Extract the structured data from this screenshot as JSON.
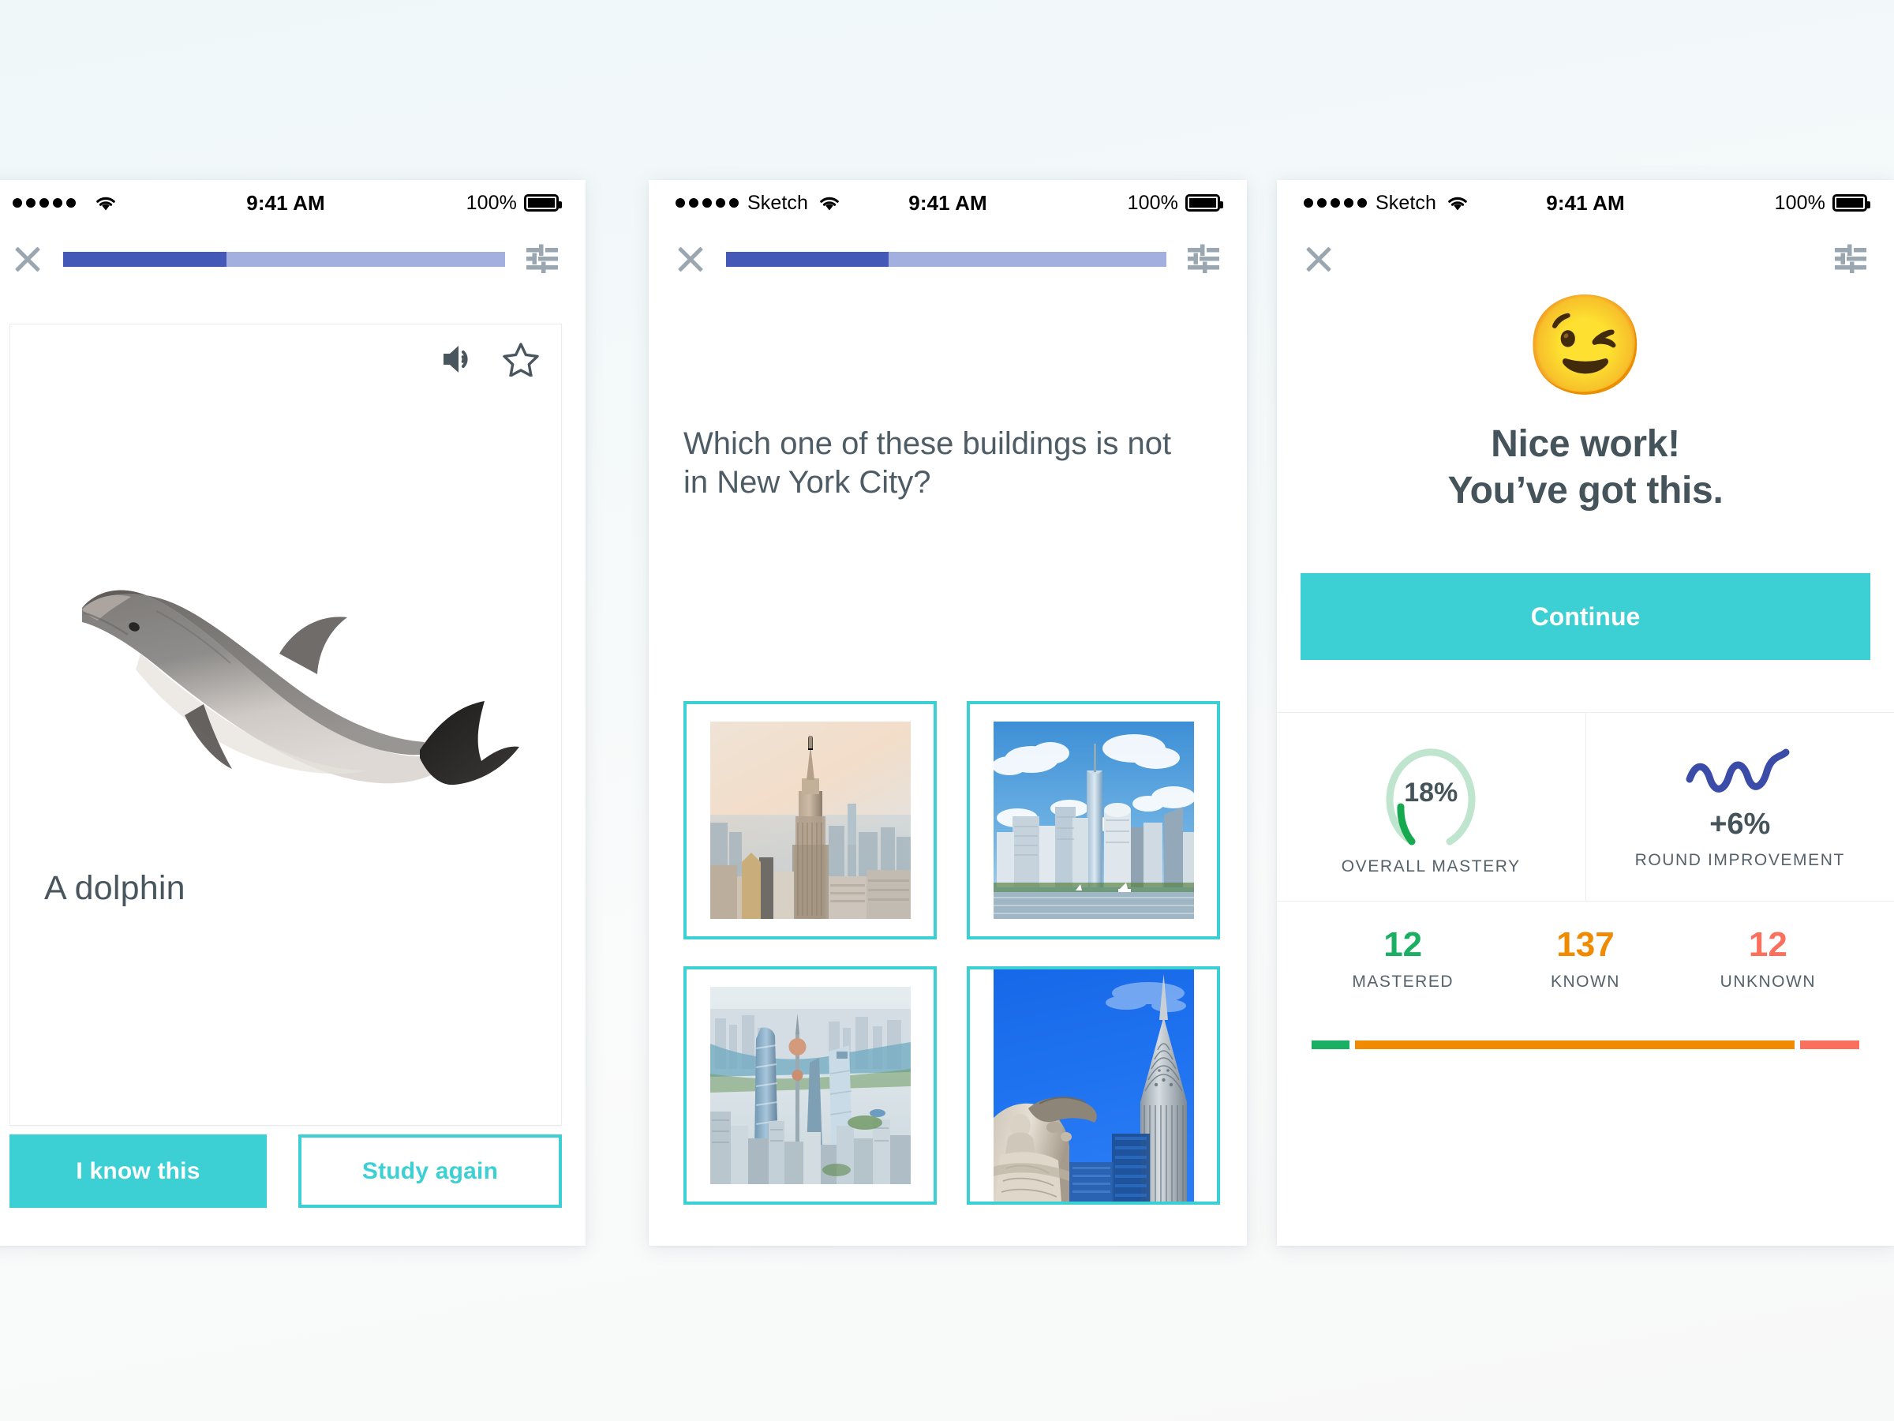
{
  "theme": {
    "teal": "#3ccfd4",
    "slate": "#45535b",
    "progress_fill": "#4458b8",
    "progress_track": "#a3afdf",
    "green": "#1aaf63",
    "orange": "#f08a00",
    "salmon": "#fb6f5d",
    "ring_track": "#bfe5cf",
    "ring_fill": "#17a94f",
    "squiggle_blue": "#3b4ba8"
  },
  "statusbar": {
    "time": "9:41 AM",
    "battery_percent": "100%",
    "carrier_blank": "",
    "carrier_sketch": "Sketch",
    "signal_dots": 5,
    "wifi_icon": "wifi-icon",
    "battery_icon": "battery-icon"
  },
  "navbar": {
    "close_icon": "close-icon",
    "settings_icon": "sliders-icon",
    "progress_percent": 37
  },
  "screen1": {
    "name": "flashcard",
    "audio_icon": "speaker-icon",
    "star_icon": "star-outline-icon",
    "image_alt": "dolphin-photo",
    "term": "A dolphin",
    "primary_button": "I know this",
    "secondary_button": "Study again"
  },
  "screen2": {
    "name": "multiple-choice",
    "question": "Which one of these buildings is not in New York City?",
    "choices": [
      {
        "id": "choice-empire-state",
        "alt": "empire-state-building-photo"
      },
      {
        "id": "choice-one-world-trade",
        "alt": "one-world-trade-center-photo"
      },
      {
        "id": "choice-shanghai",
        "alt": "shanghai-skyline-photo"
      },
      {
        "id": "choice-chrysler",
        "alt": "chrysler-building-photo"
      }
    ]
  },
  "screen3": {
    "name": "round-results",
    "emoji": "😉",
    "emoji_name": "winking-face-emoji",
    "headline_line1": "Nice work!",
    "headline_line2": "You’ve got this.",
    "continue_button": "Continue",
    "stats": [
      {
        "id": "overall-mastery",
        "value": "18%",
        "caption": "OVERALL MASTERY",
        "percent": 18
      },
      {
        "id": "round-improvement",
        "value": "+6%",
        "caption": "ROUND IMPROVEMENT"
      }
    ],
    "counts": [
      {
        "id": "mastered",
        "num": "12",
        "label": "MASTERED",
        "color": "#1aaf63",
        "share": 7
      },
      {
        "id": "known",
        "num": "137",
        "label": "KNOWN",
        "color": "#f08a00",
        "share": 82
      },
      {
        "id": "unknown",
        "num": "12",
        "label": "UNKNOWN",
        "color": "#fb6f5d",
        "share": 11
      }
    ]
  }
}
